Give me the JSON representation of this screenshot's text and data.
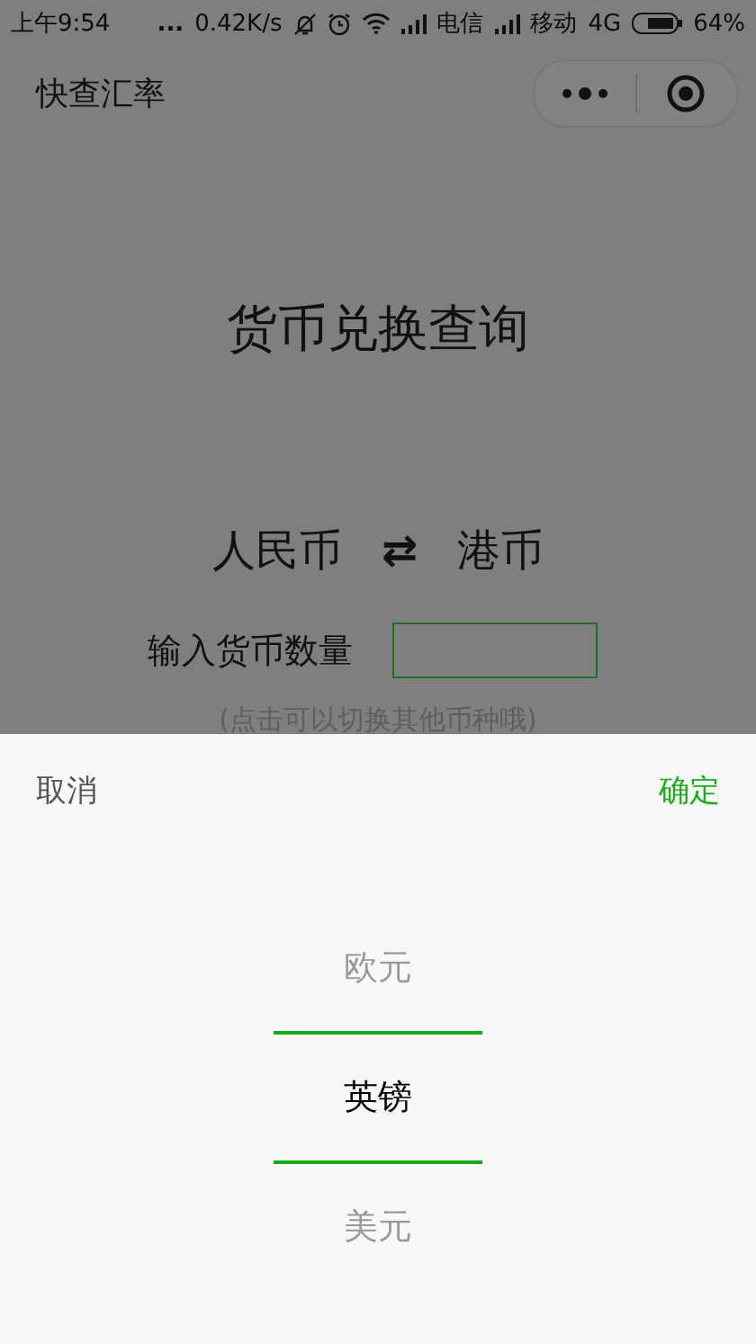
{
  "status_bar": {
    "time": "上午9:54",
    "dots": "...",
    "speed": "0.42K/s",
    "carrier_1": "电信",
    "carrier_2": "移动",
    "network": "4G",
    "battery": "64%"
  },
  "nav_bar": {
    "title": "快查汇率"
  },
  "page": {
    "heading": "货币兑换查询",
    "from_currency": "人民币",
    "swap": "⇄",
    "to_currency": "港币",
    "amount_label": "输入货币数量",
    "hint": "(点击可以切换其他币种哦)"
  },
  "picker": {
    "cancel": "取消",
    "confirm": "确定",
    "options": [
      {
        "label": "欧元",
        "selected": false
      },
      {
        "label": "英镑",
        "selected": true
      },
      {
        "label": "美元",
        "selected": false
      }
    ]
  }
}
